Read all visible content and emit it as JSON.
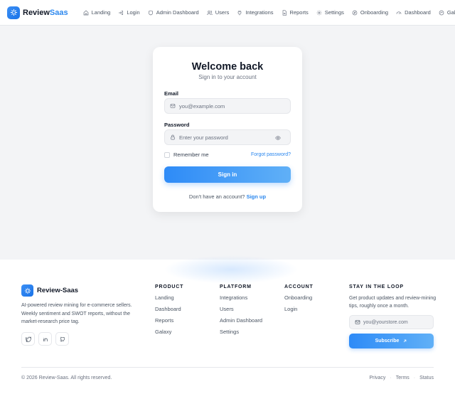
{
  "brand": {
    "name_primary": "Review",
    "name_accent": "Saas"
  },
  "nav": {
    "items": [
      {
        "label": "Landing",
        "icon": "home-icon"
      },
      {
        "label": "Login",
        "icon": "login-icon"
      },
      {
        "label": "Admin Dashboard",
        "icon": "shield-icon"
      },
      {
        "label": "Users",
        "icon": "users-icon"
      },
      {
        "label": "Integrations",
        "icon": "plug-icon"
      },
      {
        "label": "Reports",
        "icon": "file-icon"
      },
      {
        "label": "Settings",
        "icon": "gear-icon"
      },
      {
        "label": "Onboarding",
        "icon": "compass-icon"
      },
      {
        "label": "Dashboard",
        "icon": "gauge-icon"
      },
      {
        "label": "Galaxy",
        "icon": "galaxy-icon"
      }
    ]
  },
  "login": {
    "title": "Welcome back",
    "subtitle": "Sign in to your account",
    "email_label": "Email",
    "email_placeholder": "you@example.com",
    "password_label": "Password",
    "password_placeholder": "Enter your password",
    "remember_label": "Remember me",
    "forgot_label": "Forgot password?",
    "submit_label": "Sign in",
    "signup_prompt": "Don't have an account?",
    "signup_link": "Sign up"
  },
  "footer": {
    "brand_name": "Review-Saas",
    "description": "AI-powered review mining for e-commerce sellers. Weekly sentiment and SWOT reports, without the market-research price tag.",
    "socials": [
      "twitter-icon",
      "linkedin-icon",
      "github-icon"
    ],
    "columns": [
      {
        "title": "PRODUCT",
        "items": [
          "Landing",
          "Dashboard",
          "Reports",
          "Galaxy"
        ]
      },
      {
        "title": "PLATFORM",
        "items": [
          "Integrations",
          "Users",
          "Admin Dashboard",
          "Settings"
        ]
      },
      {
        "title": "ACCOUNT",
        "items": [
          "Onboarding",
          "Login"
        ]
      }
    ],
    "newsletter": {
      "title": "STAY IN THE LOOP",
      "description": "Get product updates and review-mining tips, roughly once a month.",
      "email_placeholder": "you@yourstore.com",
      "button_label": "Subscribe"
    },
    "copyright": "© 2026 Review-Saas. All rights reserved.",
    "links": [
      "Privacy",
      "Terms",
      "Status"
    ]
  },
  "colors": {
    "accent": "#2b87ee",
    "background": "#f3f4f6"
  }
}
